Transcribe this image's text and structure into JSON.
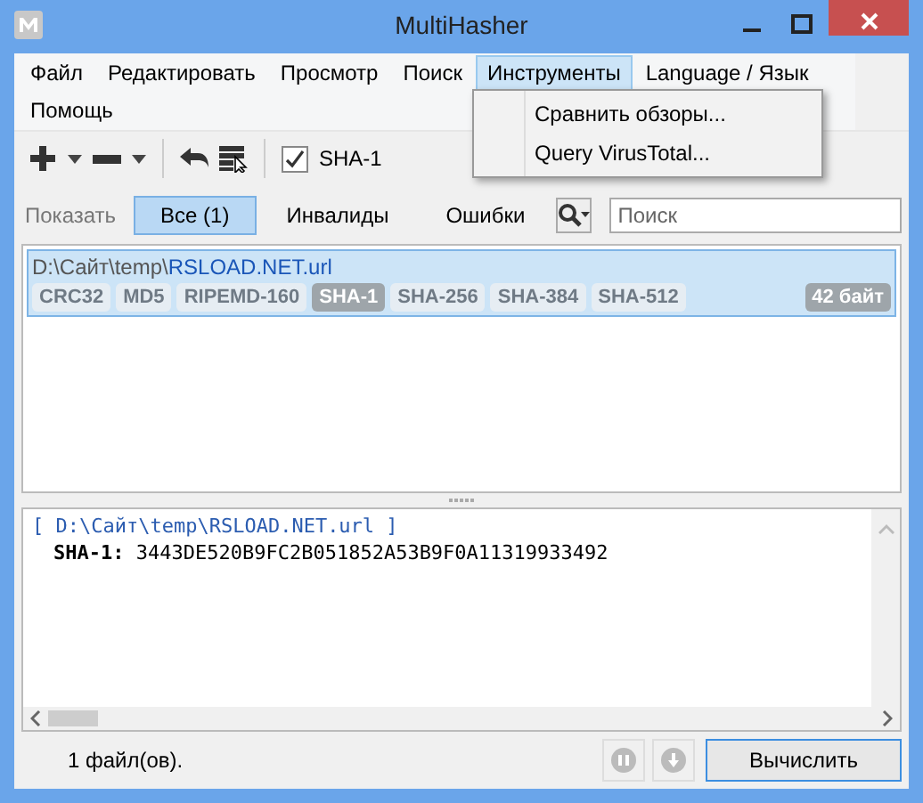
{
  "window": {
    "title": "MultiHasher"
  },
  "menu": [
    {
      "label": "Файл",
      "selected": false
    },
    {
      "label": "Редактировать",
      "selected": false
    },
    {
      "label": "Просмотр",
      "selected": false
    },
    {
      "label": "Поиск",
      "selected": false
    },
    {
      "label": "Инструменты",
      "selected": true
    },
    {
      "label": "Language / Язык",
      "selected": false
    },
    {
      "label": "Помощь",
      "selected": false
    }
  ],
  "dropdown": [
    "Сравнить обзоры...",
    "Query VirusTotal..."
  ],
  "toolbar": {
    "algorithm": {
      "label": "SHA-1",
      "checked": true
    }
  },
  "filter": {
    "label": "Показать",
    "tabs": [
      {
        "label": "Все (1)",
        "selected": true
      },
      {
        "label": "Инвалиды",
        "selected": false
      },
      {
        "label": "Ошибки",
        "selected": false
      }
    ],
    "search": {
      "placeholder": "Поиск"
    }
  },
  "files": [
    {
      "dir": "D:\\Сайт\\temp\\",
      "name": "RSLOAD.NET.url",
      "size": "42 байт",
      "selected": true,
      "hashes": [
        {
          "label": "CRC32",
          "selected": false
        },
        {
          "label": "MD5",
          "selected": false
        },
        {
          "label": "RIPEMD-160",
          "selected": false
        },
        {
          "label": "SHA-1",
          "selected": true
        },
        {
          "label": "SHA-256",
          "selected": false
        },
        {
          "label": "SHA-384",
          "selected": false
        },
        {
          "label": "SHA-512",
          "selected": false
        }
      ]
    }
  ],
  "output": {
    "header": "[ D:\\Сайт\\temp\\RSLOAD.NET.url ]",
    "lines": [
      "**SHA-1:** 3443DE520B9FC2B051852A53B9F0A11319933492"
    ]
  },
  "status": {
    "text": "1 файл(ов).",
    "compute_button": "Вычислить"
  }
}
